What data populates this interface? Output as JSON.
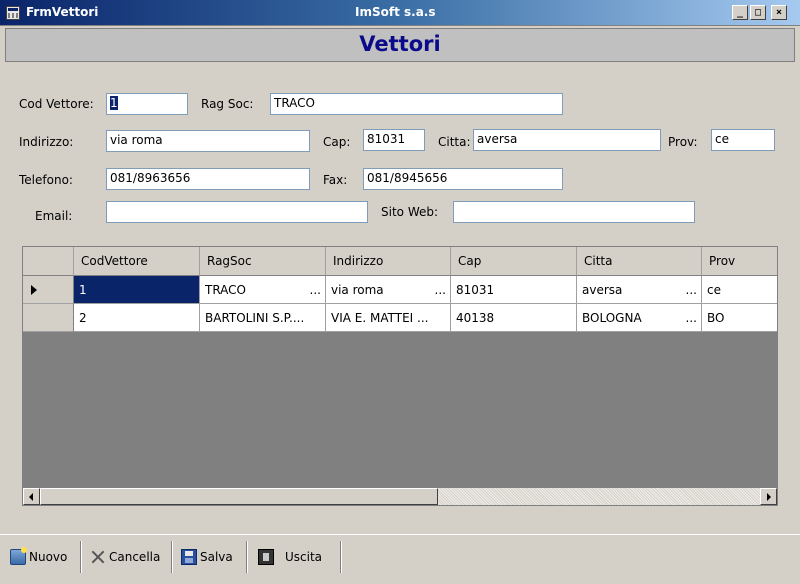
{
  "window": {
    "title": "FrmVettori",
    "company": "ImSoft s.a.s",
    "minimize_glyph": "_",
    "maximize_glyph": "□",
    "close_glyph": "×"
  },
  "header": {
    "title": "Vettori"
  },
  "form": {
    "cod_vettore_label": "Cod Vettore:",
    "cod_vettore_value": "1",
    "rag_soc_label": "Rag Soc:",
    "rag_soc_value": "TRACO",
    "indirizzo_label": "Indirizzo:",
    "indirizzo_value": "via roma",
    "cap_label": "Cap:",
    "cap_value": "81031",
    "citta_label": "Citta:",
    "citta_value": "aversa",
    "prov_label": "Prov:",
    "prov_value": "ce",
    "telefono_label": "Telefono:",
    "telefono_value": "081/8963656",
    "fax_label": "Fax:",
    "fax_value": "081/8945656",
    "email_label": "Email:",
    "email_value": "",
    "sito_web_label": "Sito Web:",
    "sito_web_value": ""
  },
  "grid": {
    "columns": [
      "CodVettore",
      "RagSoc",
      "Indirizzo",
      "Cap",
      "Citta",
      "Prov"
    ],
    "rows": [
      {
        "cod": "1",
        "ragsoc": "TRACO",
        "indirizzo": "via roma",
        "cap": "81031",
        "citta": "aversa",
        "prov": "ce"
      },
      {
        "cod": "2",
        "ragsoc": "BARTOLINI S.P....",
        "indirizzo": "VIA E. MATTEI ...",
        "cap": "40138",
        "citta": "BOLOGNA",
        "prov": "BO"
      }
    ],
    "ellipsis": "..."
  },
  "toolbar": {
    "nuovo": "Nuovo",
    "cancella": "Cancella",
    "salva": "Salva",
    "uscita": "Uscita"
  },
  "icons": {
    "app": "form-icon",
    "nuovo": "new-record-icon",
    "cancella": "delete-x-icon",
    "salva": "floppy-disk-icon",
    "uscita": "exit-door-icon"
  }
}
